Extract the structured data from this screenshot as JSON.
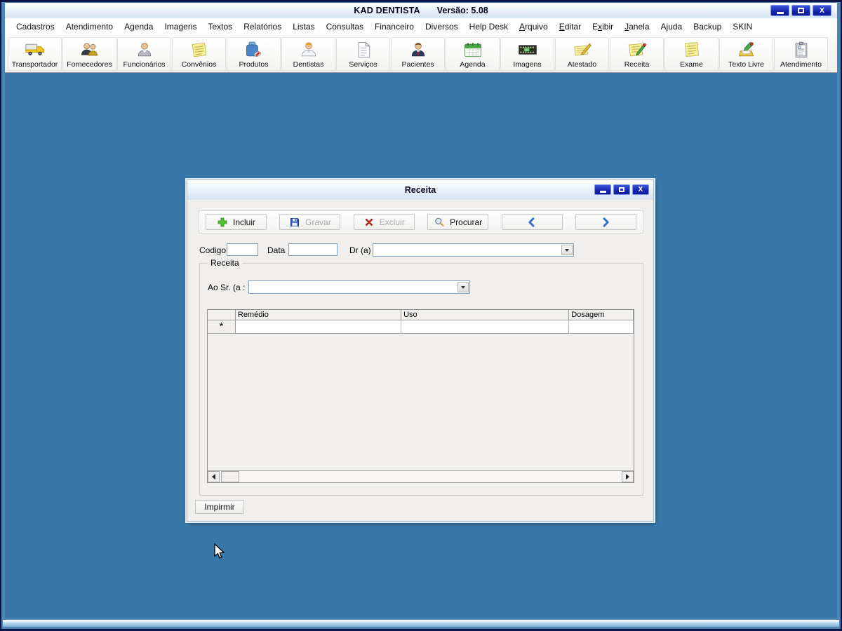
{
  "window": {
    "title": "KAD DENTISTA",
    "version": "Versão: 5.08",
    "controls": {
      "close": "X"
    }
  },
  "colors": {
    "desktop_blue": "#3878a8",
    "titlebar_button_navy": "#1423ae",
    "icon_green": "#52c435",
    "icon_red": "#d83a2a",
    "icon_blue": "#2a52c8",
    "chevron_blue": "#2f6fd0",
    "disabled_text": "#a8a8a8"
  },
  "menubar": {
    "items": [
      {
        "label": "Cadastros",
        "u": -1
      },
      {
        "label": "Atendimento",
        "u": -1
      },
      {
        "label": "Agenda",
        "u": -1
      },
      {
        "label": "Imagens",
        "u": -1
      },
      {
        "label": "Textos",
        "u": -1
      },
      {
        "label": "Relatórios",
        "u": -1
      },
      {
        "label": "Listas",
        "u": -1
      },
      {
        "label": "Consultas",
        "u": -1
      },
      {
        "label": "Financeiro",
        "u": -1
      },
      {
        "label": "Diversos",
        "u": -1
      },
      {
        "label": "Help Desk",
        "u": -1
      },
      {
        "label": "Arquivo",
        "u": 0
      },
      {
        "label": "Editar",
        "u": 0
      },
      {
        "label": "Exibir",
        "u": 1
      },
      {
        "label": "Janela",
        "u": 0
      },
      {
        "label": "Ajuda",
        "u": 1
      },
      {
        "label": "Backup",
        "u": -1
      },
      {
        "label": "SKIN",
        "u": -1
      }
    ]
  },
  "toolbar": {
    "items": [
      {
        "name": "transportador",
        "label": "Transportador",
        "icon": "truck-icon"
      },
      {
        "name": "fornecedores",
        "label": "Fornecedores",
        "icon": "suppliers-icon"
      },
      {
        "name": "funcionarios",
        "label": "Funcionários",
        "icon": "employee-icon"
      },
      {
        "name": "convenios",
        "label": "Convênios",
        "icon": "note-pad-icon"
      },
      {
        "name": "produtos",
        "label": "Produtos",
        "icon": "medicine-bottle-icon"
      },
      {
        "name": "dentistas",
        "label": "Dentistas",
        "icon": "dentist-icon"
      },
      {
        "name": "servicos",
        "label": "Serviços",
        "icon": "document-icon"
      },
      {
        "name": "pacientes",
        "label": "Pacientes",
        "icon": "patient-icon"
      },
      {
        "name": "agenda",
        "label": "Agenda",
        "icon": "calendar-icon"
      },
      {
        "name": "imagens",
        "label": "Imagens",
        "icon": "filmstrip-icon"
      },
      {
        "name": "atestado",
        "label": "Atestado",
        "icon": "pen-paper-icon"
      },
      {
        "name": "receita",
        "label": "Receita",
        "icon": "note-pencil-icon"
      },
      {
        "name": "exame",
        "label": "Exame",
        "icon": "yellow-note-icon"
      },
      {
        "name": "texto-livre",
        "label": "Texto Livre",
        "icon": "pencil-holder-icon"
      },
      {
        "name": "atendimento",
        "label": "Atendimento",
        "icon": "clipboard-icon"
      }
    ]
  },
  "dialog": {
    "title": "Receita",
    "controls": {
      "close": "X"
    },
    "toolbar": {
      "buttons": [
        {
          "name": "incluir-button",
          "label": "Incluir",
          "icon": "plus-icon",
          "enabled": true
        },
        {
          "name": "gravar-button",
          "label": "Gravar",
          "icon": "floppy-icon",
          "enabled": false
        },
        {
          "name": "excluir-button",
          "label": "Excluir",
          "icon": "delete-x-icon",
          "enabled": false
        },
        {
          "name": "procurar-button",
          "label": "Procurar",
          "icon": "search-icon",
          "enabled": true
        },
        {
          "name": "previous-button",
          "label": "",
          "icon": "chevron-left-icon",
          "enabled": true
        },
        {
          "name": "next-button",
          "label": "",
          "icon": "chevron-right-icon",
          "enabled": true
        }
      ]
    },
    "fields": {
      "codigo_label": "Codigo",
      "codigo_value": "",
      "data_label": "Data",
      "data_value": "",
      "dr_label": "Dr (a) :",
      "dr_value": ""
    },
    "groupbox": {
      "legend": "Receita",
      "ao_sr_label": "Ao Sr. (a  :",
      "ao_sr_value": ""
    },
    "grid": {
      "columns": [
        "Remédio",
        "Uso",
        "Dosagem"
      ],
      "rows": [
        {
          "selector": "*",
          "cells": [
            "",
            "",
            ""
          ]
        }
      ]
    },
    "print_button": "Impirmir"
  }
}
